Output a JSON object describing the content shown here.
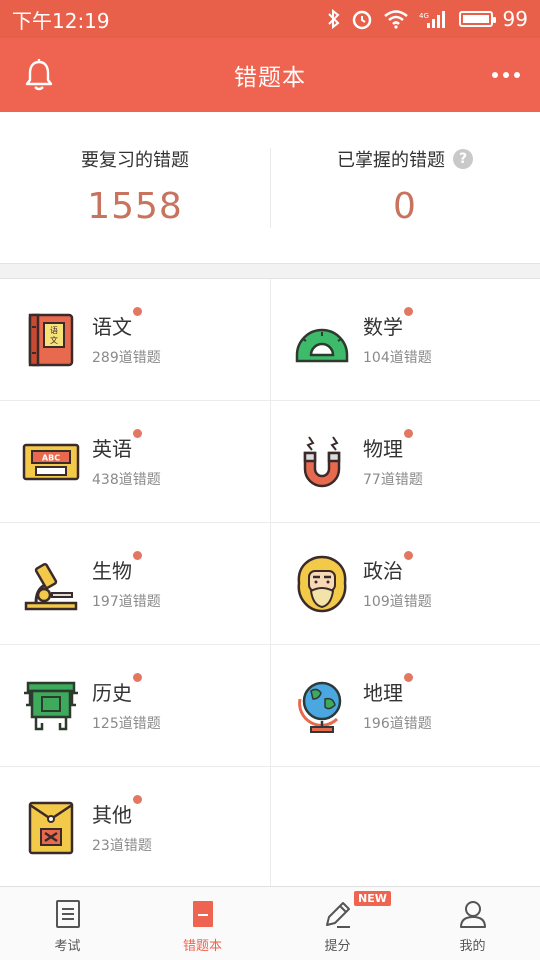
{
  "status": {
    "time": "下午12:19",
    "battery": "99"
  },
  "header": {
    "title": "错题本"
  },
  "summary": {
    "review_label": "要复习的错题",
    "review_count": "1558",
    "mastered_label": "已掌握的错题",
    "mastered_count": "0",
    "help_glyph": "?"
  },
  "subjects": [
    {
      "name": "语文",
      "count": "289道错题",
      "icon": "book-icon"
    },
    {
      "name": "数学",
      "count": "104道错题",
      "icon": "protractor-icon"
    },
    {
      "name": "英语",
      "count": "438道错题",
      "icon": "cassette-icon"
    },
    {
      "name": "物理",
      "count": "77道错题",
      "icon": "magnet-icon"
    },
    {
      "name": "生物",
      "count": "197道错题",
      "icon": "microscope-icon"
    },
    {
      "name": "政治",
      "count": "109道错题",
      "icon": "marx-portrait-icon"
    },
    {
      "name": "历史",
      "count": "125道错题",
      "icon": "bronze-vessel-icon"
    },
    {
      "name": "地理",
      "count": "196道错题",
      "icon": "globe-icon"
    },
    {
      "name": "其他",
      "count": "23道错题",
      "icon": "envelope-icon"
    }
  ],
  "tabs": [
    {
      "label": "考试",
      "icon": "exam-icon"
    },
    {
      "label": "错题本",
      "icon": "notebook-icon",
      "active": true
    },
    {
      "label": "提分",
      "icon": "pencil-icon",
      "badge": "NEW"
    },
    {
      "label": "我的",
      "icon": "user-icon"
    }
  ],
  "colors": {
    "accent": "#ef6450",
    "status_bar": "#e9604a",
    "value": "#c8735e",
    "dot": "#e37862"
  }
}
